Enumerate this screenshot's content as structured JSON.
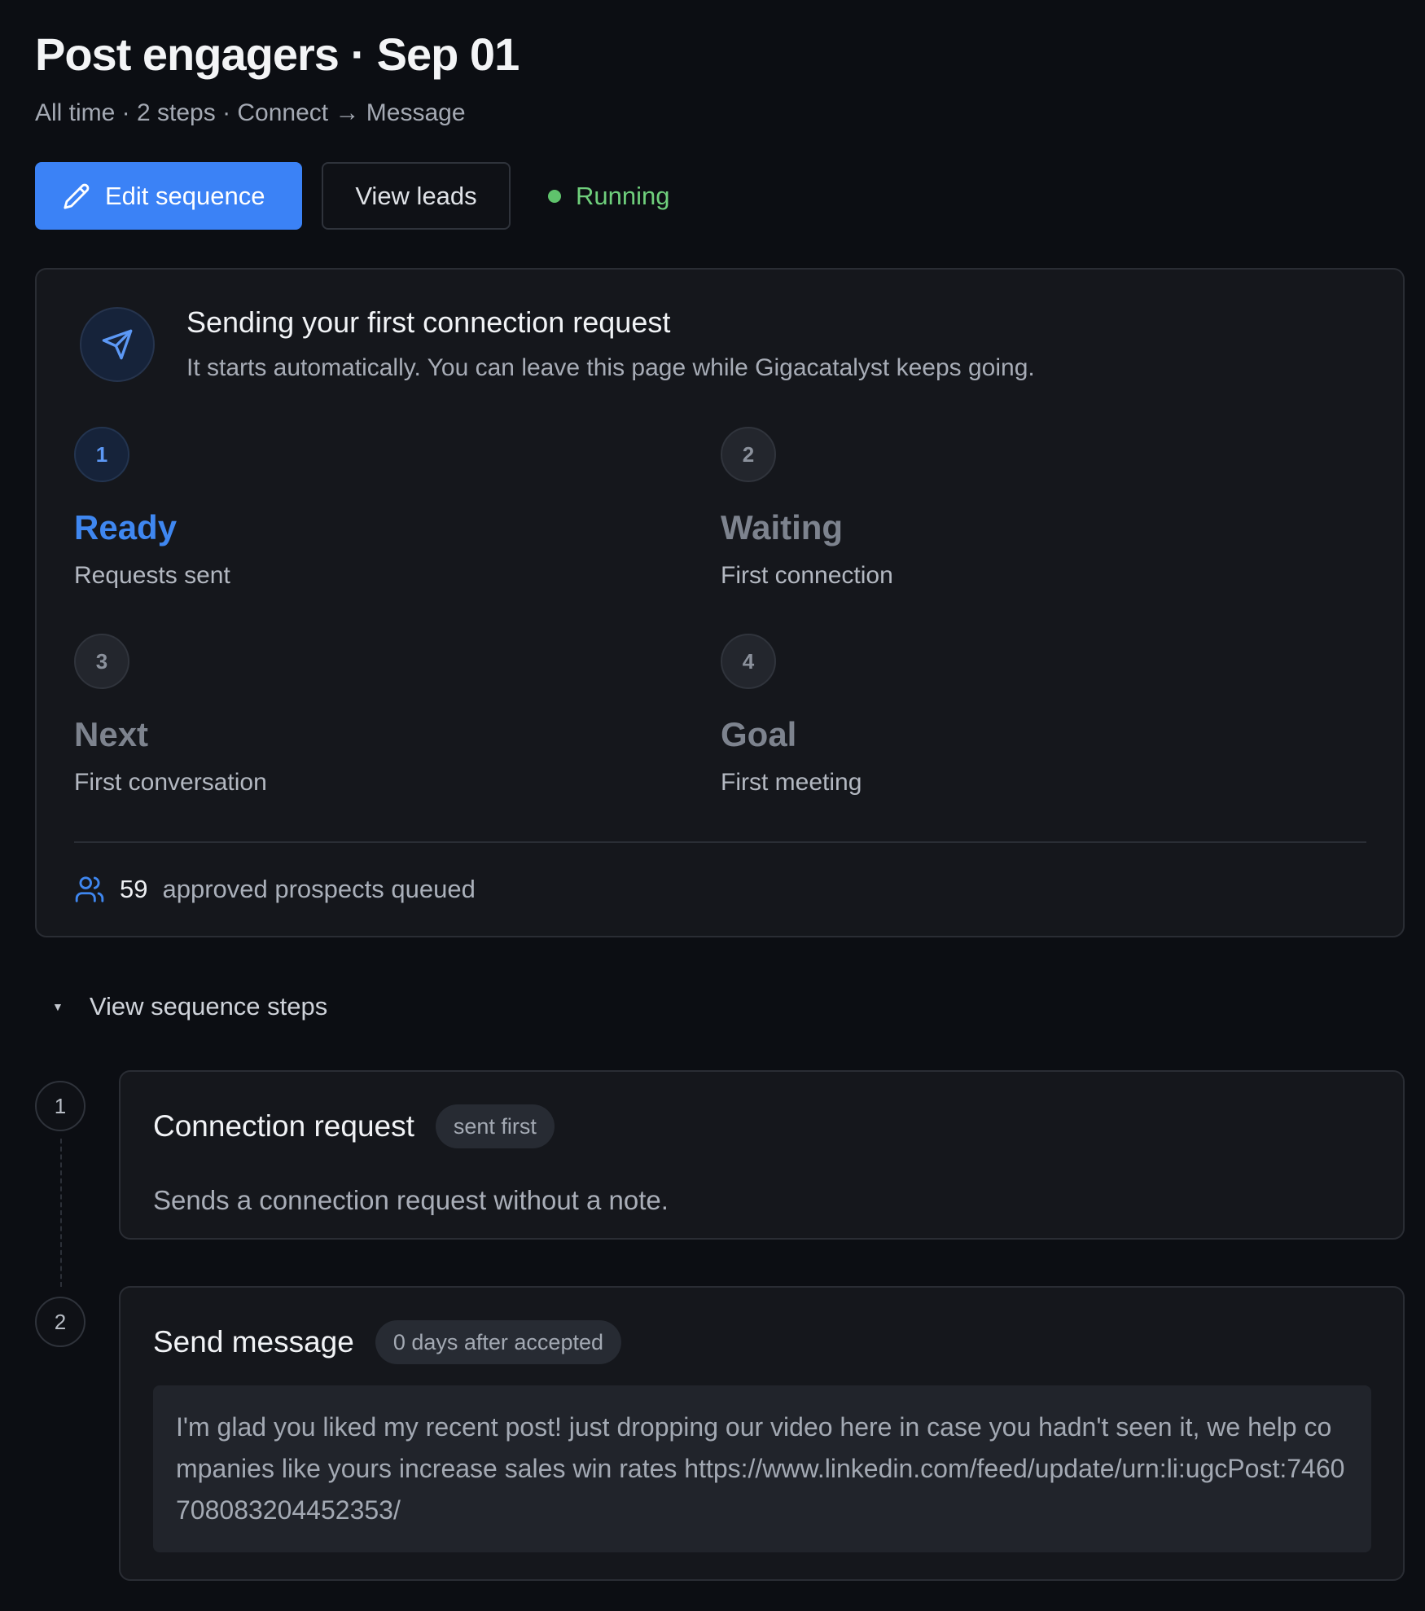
{
  "header": {
    "title": "Post engagers · Sep 01",
    "subtitle": "All time · 2 steps · Connect → Message"
  },
  "actions": {
    "edit_label": "Edit sequence",
    "view_leads_label": "View leads",
    "status_label": "Running"
  },
  "progress_card": {
    "title": "Sending your first connection request",
    "description": "It starts automatically. You can leave this page while Gigacatalyst keeps going.",
    "steps": [
      {
        "number": "1",
        "label": "Ready",
        "sub": "Requests sent",
        "active": true
      },
      {
        "number": "2",
        "label": "Waiting",
        "sub": "First connection",
        "active": false
      },
      {
        "number": "3",
        "label": "Next",
        "sub": "First conversation",
        "active": false
      },
      {
        "number": "4",
        "label": "Goal",
        "sub": "First meeting",
        "active": false
      }
    ],
    "queued_count": "59",
    "queued_text": "approved prospects queued"
  },
  "sequence": {
    "toggle_label": "View sequence steps",
    "steps": [
      {
        "number": "1",
        "title": "Connection request",
        "pill": "sent first",
        "description": "Sends a connection request without a note."
      },
      {
        "number": "2",
        "title": "Send message",
        "pill": "0 days after accepted",
        "message": "I'm glad you liked my recent post! just dropping our video here in case you hadn't seen it, we help companies like yours increase sales win rates https://www.linkedin.com/feed/update/urn:li:ugcPost:7460708083204452353/"
      }
    ]
  },
  "colors": {
    "accent": "#3b82f6",
    "status_green": "#5fc36c",
    "background": "#0c0e13",
    "card": "#15171c"
  }
}
